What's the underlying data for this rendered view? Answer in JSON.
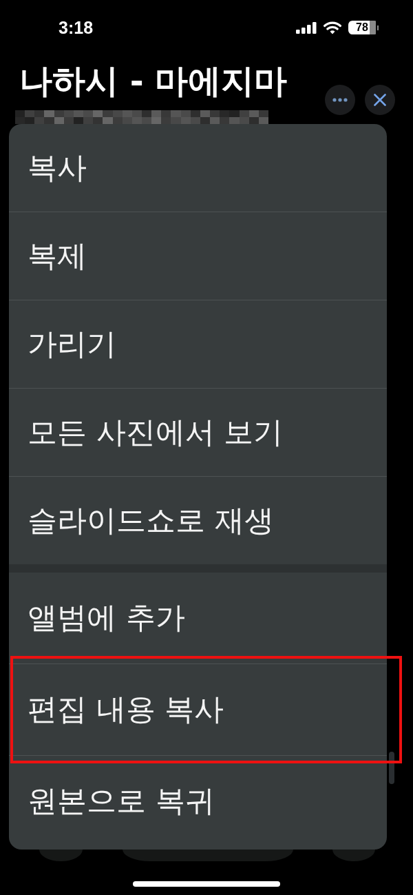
{
  "status_bar": {
    "time": "3:18",
    "battery": "78"
  },
  "header": {
    "title": "나하시 - 마에지마"
  },
  "menu": {
    "groups": [
      {
        "items": [
          {
            "label": "복사",
            "highlighted": false
          },
          {
            "label": "복제",
            "highlighted": false
          },
          {
            "label": "가리기",
            "highlighted": false
          },
          {
            "label": "모든 사진에서 보기",
            "highlighted": false
          },
          {
            "label": "슬라이드쇼로 재생",
            "highlighted": false
          }
        ]
      },
      {
        "items": [
          {
            "label": "앨범에 추가",
            "highlighted": false
          },
          {
            "label": "편집 내용 복사",
            "highlighted": true
          },
          {
            "label": "원본으로 복귀",
            "highlighted": false
          }
        ]
      }
    ]
  }
}
